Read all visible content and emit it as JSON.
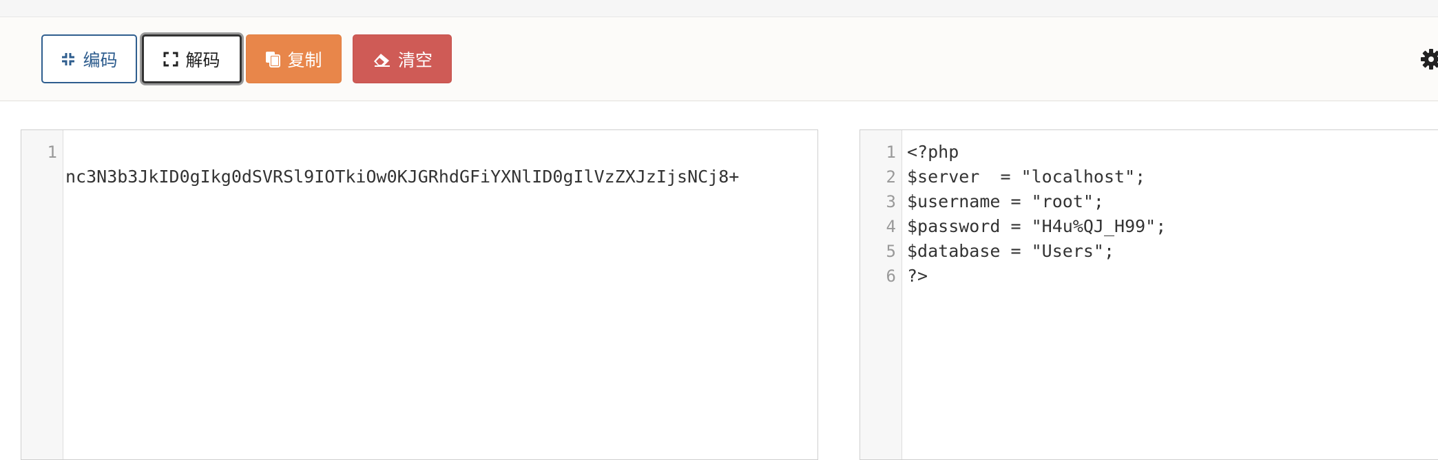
{
  "toolbar": {
    "encode_label": "编码",
    "decode_label": "解码",
    "copy_label": "复制",
    "clear_label": "清空",
    "colors": {
      "encode": "#2e5d8e",
      "copy": "#e8864a",
      "clear": "#cf5b56"
    }
  },
  "input_editor": {
    "line_numbers": [
      "1"
    ],
    "lines": [
      "nc3N3b3JkID0gIkg0dSVRSl9IOTkiOw0KJGRhdGFiYXNlID0gIlVzZXJzIjsNCj8+"
    ]
  },
  "output_editor": {
    "line_numbers": [
      "1",
      "2",
      "3",
      "4",
      "5",
      "6"
    ],
    "lines": [
      "<?php",
      "$server  = \"localhost\";",
      "$username = \"root\";",
      "$password = \"H4u%QJ_H99\";",
      "$database = \"Users\";",
      "?>"
    ]
  },
  "icons": {
    "encode": "compress-icon",
    "decode": "expand-icon",
    "copy": "copy-icon",
    "clear": "eraser-icon",
    "settings": "gear-icon"
  }
}
